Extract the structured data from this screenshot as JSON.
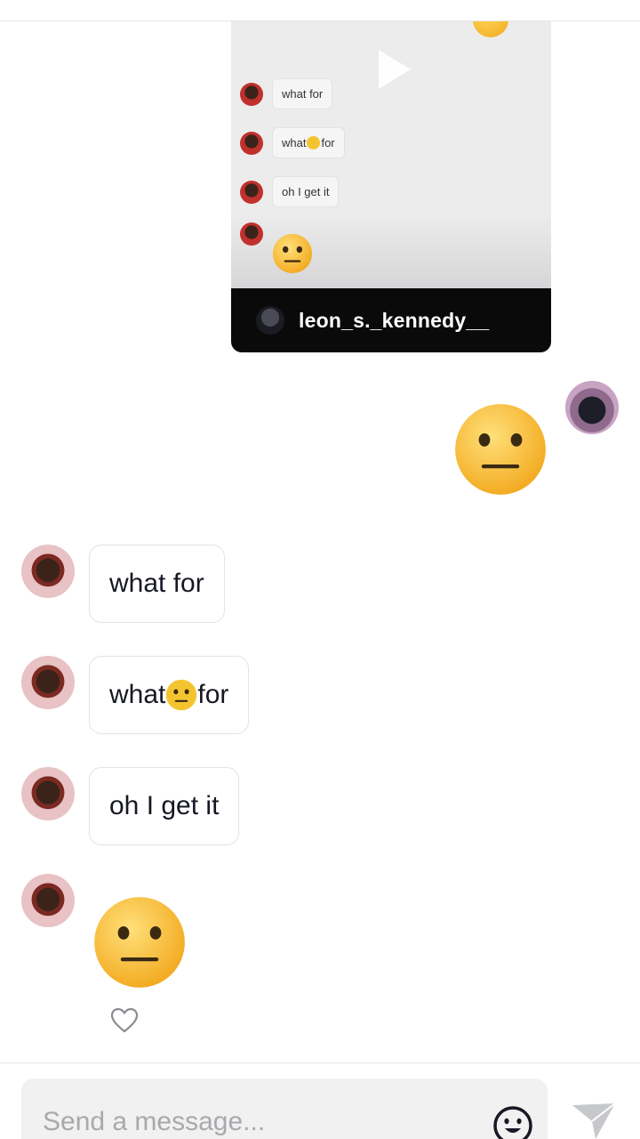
{
  "shared_video": {
    "preview_messages": [
      {
        "text": "what for"
      },
      {
        "text_before": "what",
        "text_after": "for"
      },
      {
        "text": "oh I get it"
      }
    ],
    "author_username": "leon_s._kennedy__"
  },
  "messages": [
    {
      "text": "what for"
    },
    {
      "text_before": "what",
      "text_after": "for"
    },
    {
      "text": "oh I get it"
    }
  ],
  "composer": {
    "placeholder": "Send a message..."
  },
  "icons": {
    "play": "play-icon",
    "heart": "heart-icon",
    "emoji": "emoji-smile-icon",
    "send": "send-icon",
    "emoji_reaction": "neutral-face-emoji"
  },
  "colors": {
    "accent_dark": "#0a0a0a",
    "bubble_border": "#e3e3e6",
    "emoji_yellow": "#f4c430"
  }
}
